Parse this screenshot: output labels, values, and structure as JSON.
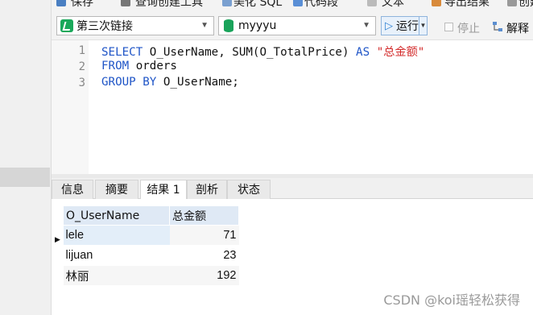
{
  "top_toolbar": {
    "items": [
      "保存",
      "查询创建工具",
      "美化 SQL",
      "代码段",
      "文本",
      "导出结果",
      "创建"
    ]
  },
  "query_toolbar": {
    "connection": "第三次链接",
    "database": "myyyu",
    "run_label": "运行",
    "stop_label": "停止",
    "explain_label": "解释"
  },
  "editor": {
    "line_numbers": [
      "1",
      "2",
      "3"
    ]
  },
  "result_tabs": [
    "信息",
    "摘要",
    "结果 1",
    "剖析",
    "状态"
  ],
  "result_grid": {
    "columns": [
      "O_UserName",
      "总金额"
    ],
    "rows": [
      {
        "name": "lele",
        "total": "71"
      },
      {
        "name": "lijuan",
        "total": "23"
      },
      {
        "name": "林丽",
        "total": "192"
      }
    ]
  },
  "watermark": "CSDN @koi瑶轻松获得"
}
